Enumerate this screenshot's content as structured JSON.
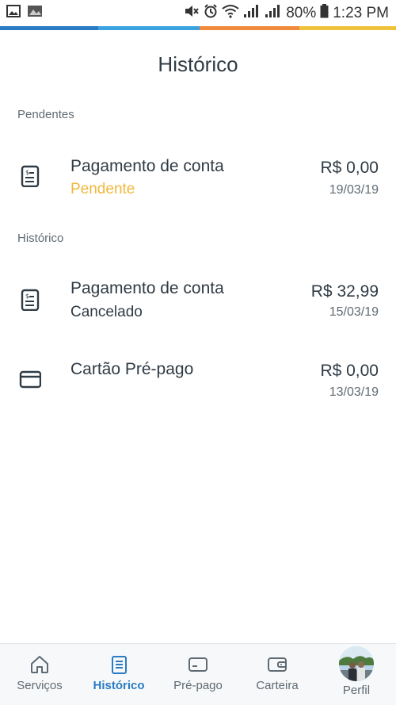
{
  "status_bar": {
    "battery": "80%",
    "time": "1:23 PM"
  },
  "stripe_colors": [
    "#2b7bc4",
    "#3ba3e0",
    "#f08a3c",
    "#f0c23c"
  ],
  "header": {
    "title": "Histórico"
  },
  "pending_section": {
    "label": "Pendentes",
    "items": [
      {
        "name": "Pagamento de conta",
        "status": "Pendente",
        "status_color": "#f0b83c",
        "amount": "R$ 0,00",
        "date": "19/03/19",
        "icon": "bill-icon"
      }
    ]
  },
  "history_section": {
    "label": "Histórico",
    "items": [
      {
        "name": "Pagamento de conta",
        "status": "Cancelado",
        "status_color": "#2f3b45",
        "amount": "R$ 32,99",
        "date": "15/03/19",
        "icon": "bill-icon"
      },
      {
        "name": "Cartão Pré-pago",
        "status": "",
        "amount": "R$ 0,00",
        "date": "13/03/19",
        "icon": "card-icon"
      }
    ]
  },
  "bottom_nav": {
    "items": [
      {
        "label": "Serviços",
        "icon": "home-icon"
      },
      {
        "label": "Histórico",
        "icon": "receipt-icon",
        "active": true
      },
      {
        "label": "Pré-pago",
        "icon": "card-icon"
      },
      {
        "label": "Carteira",
        "icon": "wallet-icon"
      },
      {
        "label": "Perfil",
        "icon": "avatar"
      }
    ]
  },
  "colors": {
    "accent": "#2b7bc4",
    "pending": "#f0b83c",
    "text": "#2f3b45"
  }
}
